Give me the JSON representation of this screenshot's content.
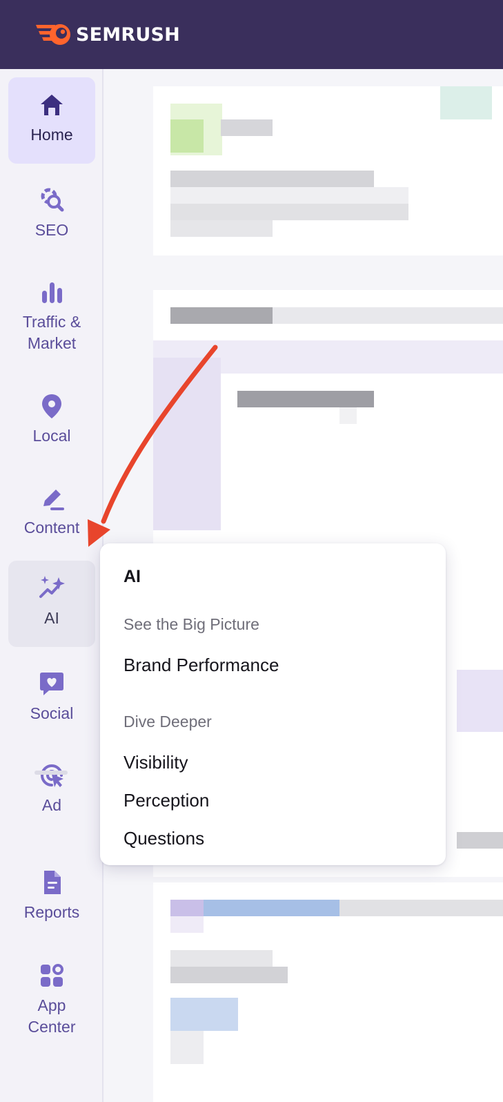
{
  "brand": {
    "name": "SEMRUSH",
    "logo_icon": "semrush-fireball-icon",
    "colors": {
      "header_bg": "#3a2f5c",
      "logo_orange": "#ff642d",
      "nav_purple": "#7a6bc8"
    }
  },
  "sidebar": {
    "items": [
      {
        "label": "Home",
        "icon": "home-icon",
        "state": "active"
      },
      {
        "label": "SEO",
        "icon": "seo-gear-search-icon",
        "state": "default"
      },
      {
        "label": "Traffic &\nMarket",
        "icon": "bar-chart-icon",
        "state": "default"
      },
      {
        "label": "Local",
        "icon": "map-pin-icon",
        "state": "default"
      },
      {
        "label": "Content",
        "icon": "pencil-icon",
        "state": "default"
      },
      {
        "label": "AI",
        "icon": "sparkles-trend-icon",
        "state": "hovered"
      },
      {
        "label": "Social",
        "icon": "chat-heart-icon",
        "state": "default"
      },
      {
        "label": "Ad",
        "icon": "target-cursor-icon",
        "state": "default"
      },
      {
        "label": "Reports",
        "icon": "document-icon",
        "state": "default"
      },
      {
        "label": "App\nCenter",
        "icon": "apps-grid-icon",
        "state": "default"
      }
    ]
  },
  "ai_menu": {
    "title": "AI",
    "sections": [
      {
        "heading": "See the Big Picture",
        "links": [
          "Brand Performance"
        ]
      },
      {
        "heading": "Dive Deeper",
        "links": [
          "Visibility",
          "Perception",
          "Questions"
        ]
      }
    ]
  },
  "annotation": {
    "arrow_color": "#e8452c",
    "points_to": "AI"
  }
}
